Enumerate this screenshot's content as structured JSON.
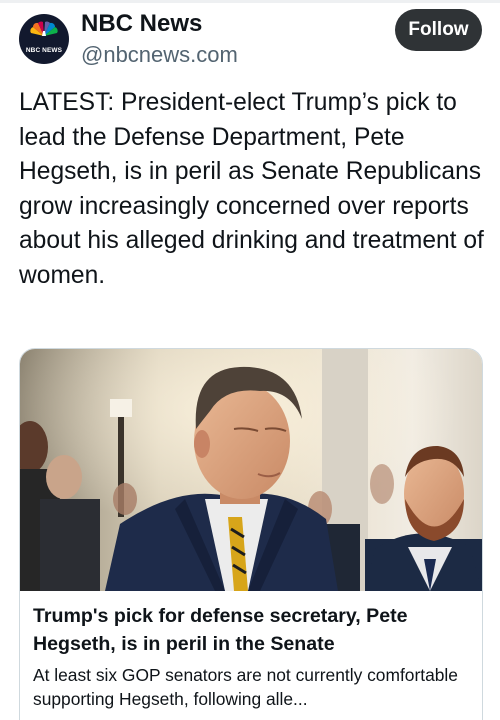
{
  "post": {
    "display_name": "NBC News",
    "handle": "@nbcnews.com",
    "avatar_label": "NBC NEWS",
    "follow_label": "Follow",
    "text": "LATEST: President-elect Trump’s pick to lead the Defense Department, Pete Hegseth, is in peril as Senate Republicans grow increasingly concerned over reports about his alleged drinking and treatment of women."
  },
  "link_card": {
    "title": "Trump's pick for defense secretary, Pete Hegseth, is in peril in the Senate",
    "description": "At least six GOP senators are not currently comfortable supporting Hegseth, following alle..."
  },
  "colors": {
    "text": "#0f1419",
    "secondary_text": "#536471",
    "follow_button_bg": "#2f3336",
    "card_border": "#cfd9de",
    "avatar_bg": "#12192e"
  }
}
